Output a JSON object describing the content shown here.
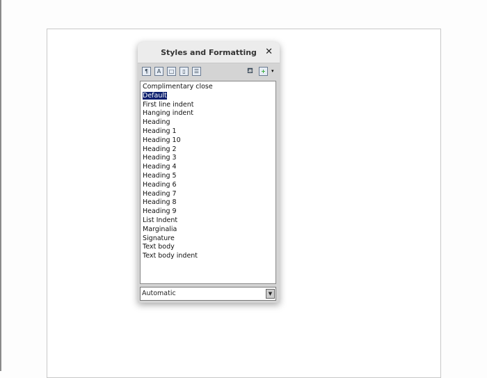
{
  "dialog": {
    "title": "Styles and Formatting",
    "close": "✕"
  },
  "toolbar": [
    {
      "name": "paragraph-styles-icon",
      "glyph": "¶"
    },
    {
      "name": "character-styles-icon",
      "glyph": "A"
    },
    {
      "name": "frame-styles-icon",
      "glyph": "□"
    },
    {
      "name": "page-styles-icon",
      "glyph": "▯"
    },
    {
      "name": "list-styles-icon",
      "glyph": "☰"
    }
  ],
  "styles": [
    "Complimentary close",
    "Default",
    "First line indent",
    "Hanging indent",
    "Heading",
    "Heading 1",
    "Heading 10",
    "Heading 2",
    "Heading 3",
    "Heading 4",
    "Heading 5",
    "Heading 6",
    "Heading 7",
    "Heading 8",
    "Heading 9",
    "List Indent",
    "Marginalia",
    "Signature",
    "Text body",
    "Text body indent"
  ],
  "selected_style": "Default",
  "filter": {
    "value": "Automatic"
  }
}
